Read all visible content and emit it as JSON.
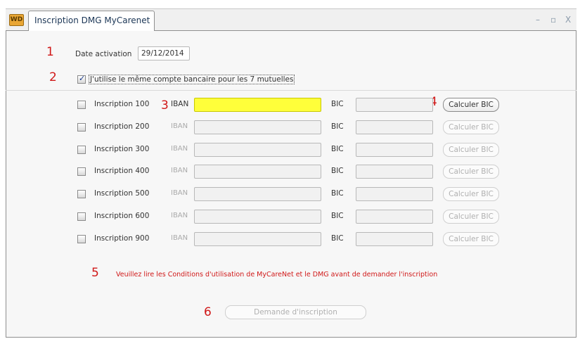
{
  "window": {
    "tab_title": "Inscription DMG MyCarenet",
    "logo": "WD",
    "controls": {
      "minimize": "–",
      "maximize": "▫",
      "close": "X"
    }
  },
  "step_numbers": [
    "1",
    "2",
    "3",
    "4",
    "5",
    "6"
  ],
  "date_activation": {
    "label": "Date activation",
    "value": "29/12/2014"
  },
  "same_account": {
    "label": "J'utilise le même compte bancaire pour les 7 mutuelles",
    "checked": true
  },
  "rows": [
    {
      "label": "Inscription 100",
      "iban_label": "IBAN",
      "bic_label": "BIC",
      "button": "Calculer BIC",
      "enabled": true
    },
    {
      "label": "Inscription 200",
      "iban_label": "IBAN",
      "bic_label": "BIC",
      "button": "Calculer BIC",
      "enabled": false
    },
    {
      "label": "Inscription 300",
      "iban_label": "IBAN",
      "bic_label": "BIC",
      "button": "Calculer BIC",
      "enabled": false
    },
    {
      "label": "Inscription 400",
      "iban_label": "IBAN",
      "bic_label": "BIC",
      "button": "Calculer BIC",
      "enabled": false
    },
    {
      "label": "Inscription 500",
      "iban_label": "IBAN",
      "bic_label": "BIC",
      "button": "Calculer BIC",
      "enabled": false
    },
    {
      "label": "Inscription 600",
      "iban_label": "IBAN",
      "bic_label": "BIC",
      "button": "Calculer BIC",
      "enabled": false
    },
    {
      "label": "Inscription 900",
      "iban_label": "IBAN",
      "bic_label": "BIC",
      "button": "Calculer BIC",
      "enabled": false
    }
  ],
  "warning": "Veuillez lire les Conditions d'utilisation de MyCareNet et le DMG avant de demander l'inscription",
  "submit_button": "Demande d'inscription",
  "colors": {
    "annotation": "#d01818",
    "active_field": "#ffff3a"
  }
}
